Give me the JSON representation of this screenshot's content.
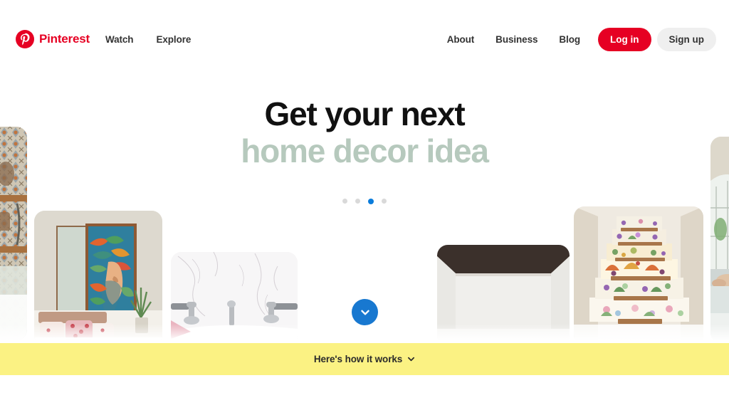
{
  "header": {
    "brand": "Pinterest",
    "brand_icon": "pinterest-logo-icon",
    "left_links": [
      {
        "label": "Watch",
        "name": "nav-link-watch"
      },
      {
        "label": "Explore",
        "name": "nav-link-explore"
      }
    ],
    "right_links": [
      {
        "label": "About",
        "name": "nav-link-about"
      },
      {
        "label": "Business",
        "name": "nav-link-business"
      },
      {
        "label": "Blog",
        "name": "nav-link-blog"
      }
    ],
    "login_label": "Log in",
    "signup_label": "Sign up"
  },
  "hero": {
    "line1": "Get your next",
    "line2": "home decor idea",
    "line2_color": "#b6c9bd"
  },
  "carousel": {
    "dot_count": 4,
    "active_index": 2,
    "active_color": "#0a7cdb",
    "inactive_color": "#d9d9d9"
  },
  "collage": {
    "cards": [
      {
        "name": "collage-card-patterned-tiles",
        "alt": "Patterned tile wall with wooden shelving"
      },
      {
        "name": "collage-card-mural-bedroom",
        "alt": "Bedroom with colorful tropical portrait mural"
      },
      {
        "name": "collage-card-marble-bathroom",
        "alt": "White marble bathroom with chrome faucet"
      },
      {
        "name": "collage-card-white-interior",
        "alt": "Minimal white room with dark ceiling band"
      },
      {
        "name": "collage-card-floral-stairs",
        "alt": "Staircase with floral patterned risers"
      },
      {
        "name": "collage-card-conservatory",
        "alt": "Bright conservatory room with plants"
      }
    ]
  },
  "scroll_button": {
    "name": "scroll-down-button",
    "icon": "chevron-down-icon",
    "color": "#1878d0"
  },
  "footer_bar": {
    "label": "Here's how it works",
    "icon": "chevron-down-icon",
    "background": "#fbf283"
  },
  "colors": {
    "brand_red": "#e60023",
    "signup_gray": "#efefef",
    "yellow": "#fbf283",
    "blue": "#1878d0"
  }
}
